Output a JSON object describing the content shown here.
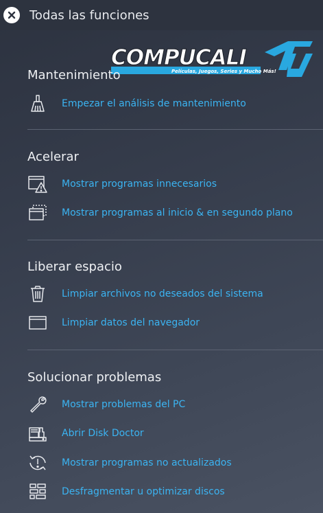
{
  "header": {
    "title": "Todas las funciones",
    "close_icon": "close-icon"
  },
  "watermark": {
    "brand": "compucalitv",
    "tagline": "Películas, Juegos, Series y Mucho Más!"
  },
  "sections": [
    {
      "title": "Mantenimiento",
      "items": [
        {
          "label": "Empezar el análisis de mantenimiento",
          "icon": "broom-icon"
        }
      ]
    },
    {
      "title": "Acelerar",
      "items": [
        {
          "label": "Mostrar programas innecesarios",
          "icon": "window-warning-icon"
        },
        {
          "label": "Mostrar programas al inicio & en segundo plano",
          "icon": "windows-stack-icon"
        }
      ]
    },
    {
      "title": "Liberar espacio",
      "items": [
        {
          "label": "Limpiar archivos no deseados del sistema",
          "icon": "trash-icon"
        },
        {
          "label": "Limpiar datos del navegador",
          "icon": "browser-window-icon"
        }
      ]
    },
    {
      "title": "Solucionar problemas",
      "items": [
        {
          "label": "Mostrar problemas del PC",
          "icon": "wrench-icon"
        },
        {
          "label": "Abrir Disk Doctor",
          "icon": "disk-doctor-icon"
        },
        {
          "label": "Mostrar programas no actualizados",
          "icon": "update-alert-icon"
        },
        {
          "label": "Desfragmentar u optimizar discos",
          "icon": "defrag-icon"
        }
      ]
    }
  ],
  "colors": {
    "link": "#3bb4f2",
    "watermark_cyan": "#29a8e0"
  }
}
